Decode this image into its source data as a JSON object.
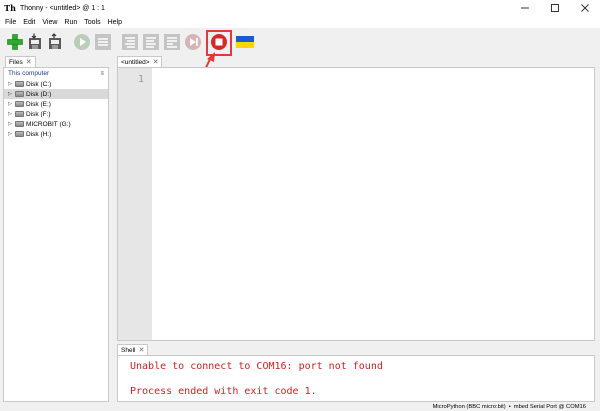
{
  "window": {
    "title": "Thonny  -  <untitled>  @  1 : 1"
  },
  "menu": [
    "File",
    "Edit",
    "View",
    "Run",
    "Tools",
    "Help"
  ],
  "toolbar": {
    "icons": [
      "new-icon",
      "open-icon",
      "save-icon",
      "run-icon",
      "debug-icon",
      "step-over-icon",
      "step-into-icon",
      "step-out-icon",
      "resume-icon",
      "stop-icon",
      "ukraine-flag-icon"
    ],
    "colors": {
      "new": "#2eaa2e",
      "stop": "#d62828",
      "flag_blue": "#1c5bd6",
      "flag_yellow": "#ffd500",
      "highlight": "#e53935"
    }
  },
  "files": {
    "tab_label": "Files",
    "header": "This computer",
    "items": [
      {
        "label": "Disk (C:)"
      },
      {
        "label": "Disk (D:)",
        "selected": true
      },
      {
        "label": "Disk (E:)"
      },
      {
        "label": "Disk (F:)"
      },
      {
        "label": "MICROBIT (G:)"
      },
      {
        "label": "Disk (H:)"
      }
    ]
  },
  "editor": {
    "tab_label": "<untitled>",
    "line_numbers": [
      "1"
    ]
  },
  "shell": {
    "tab_label": "Shell",
    "lines": [
      "Unable to connect to COM16: port not found",
      "Process ended with exit code 1."
    ]
  },
  "status": {
    "interpreter": "MicroPython (BBC micro:bit)",
    "separator": "•",
    "port": "mbed Serial Port @ COM16"
  }
}
